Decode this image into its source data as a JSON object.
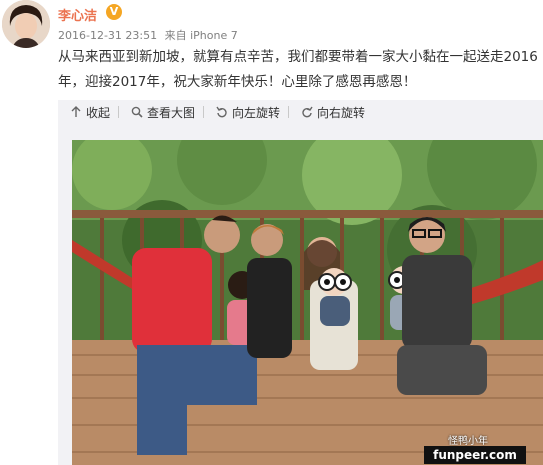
{
  "user": {
    "name": "李心洁",
    "verified_badge": "V"
  },
  "post": {
    "timestamp": "2016-12-31 23:51",
    "source": "来自 iPhone 7",
    "text_line1": "从马来西亚到新加坡，就算有点辛苦，我们都要带着一家大小黏在一起送走2016",
    "text_line2": "年，迎接2017年，祝大家新年快乐！心里除了感恩再感恩！"
  },
  "toolbar": {
    "collapse_label": "收起",
    "view_large_label": "查看大图",
    "rotate_left_label": "向左旋转",
    "rotate_right_label": "向右旋转"
  },
  "watermark": {
    "brand": "funpeer.com",
    "label": "怪鸭小年"
  },
  "colors": {
    "username": "#eb7350",
    "badge": "#f5a623",
    "toolbar_bg": "#f2f2f5"
  }
}
